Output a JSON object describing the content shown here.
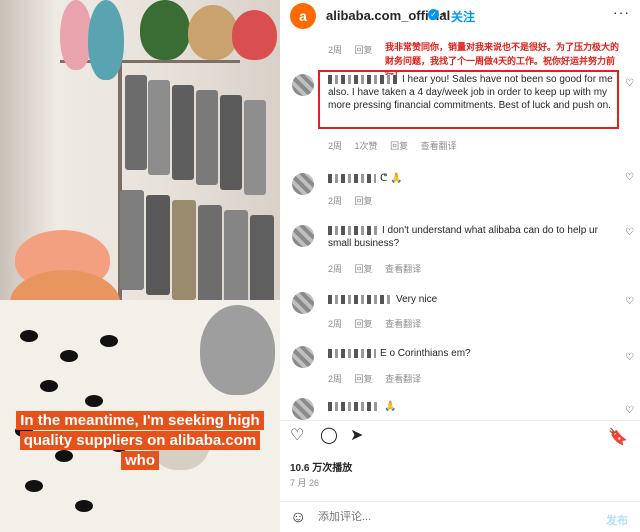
{
  "video": {
    "caption": "In the meantime, I'm seeking high quality suppliers on alibaba.com who"
  },
  "header": {
    "account": "alibaba.com_official",
    "logo_glyph": "a",
    "verified_glyph": "✓",
    "separator": "•",
    "follow_label": "关注",
    "more_glyph": "···"
  },
  "comments": {
    "top_reply": {
      "time": "2周",
      "reply": "回复",
      "translation_cn": "我非常赞同你，销量对我来说也不是很好。为了压力极大的财务问题，我找了个一周做4天的工作。祝你好运并努力前行！"
    },
    "highlighted": {
      "text": "I hear you! Sales have not been so good for me also. I have taken a 4 day/week job in order to keep up with my more pressing financial commitments. Best of luck and push on.",
      "time": "2周",
      "likes": "1次赞",
      "reply": "回复",
      "translate": "查看翻译"
    },
    "items": [
      {
        "text": "ᕦ 🙏",
        "time": "2周",
        "reply": "回复",
        "translate": ""
      },
      {
        "text": "I don't understand what alibaba can do to help ur small business?",
        "time": "2周",
        "reply": "回复",
        "translate": "查看翻译"
      },
      {
        "text": "Very nice",
        "time": "2周",
        "reply": "回复",
        "translate": "查看翻译"
      },
      {
        "text": "E o Corinthians em?",
        "time": "2周",
        "reply": "回复",
        "translate": "查看翻译"
      },
      {
        "text": "🙏",
        "time": "",
        "reply": "",
        "translate": ""
      }
    ],
    "heart_glyph": "♡"
  },
  "footer": {
    "like_glyph": "♡",
    "comment_glyph": "◯",
    "share_glyph": "➤",
    "bookmark_glyph": "🔖",
    "views": "10.6 万次播放",
    "date": "7 月 26",
    "emoji_glyph": "☺",
    "comment_placeholder": "添加评论...",
    "post_label": "发布"
  },
  "colors": {
    "accent": "#0095f6",
    "brand": "#ff6a00",
    "highlight": "#e0201a",
    "caption_bg": "#e5521b"
  }
}
